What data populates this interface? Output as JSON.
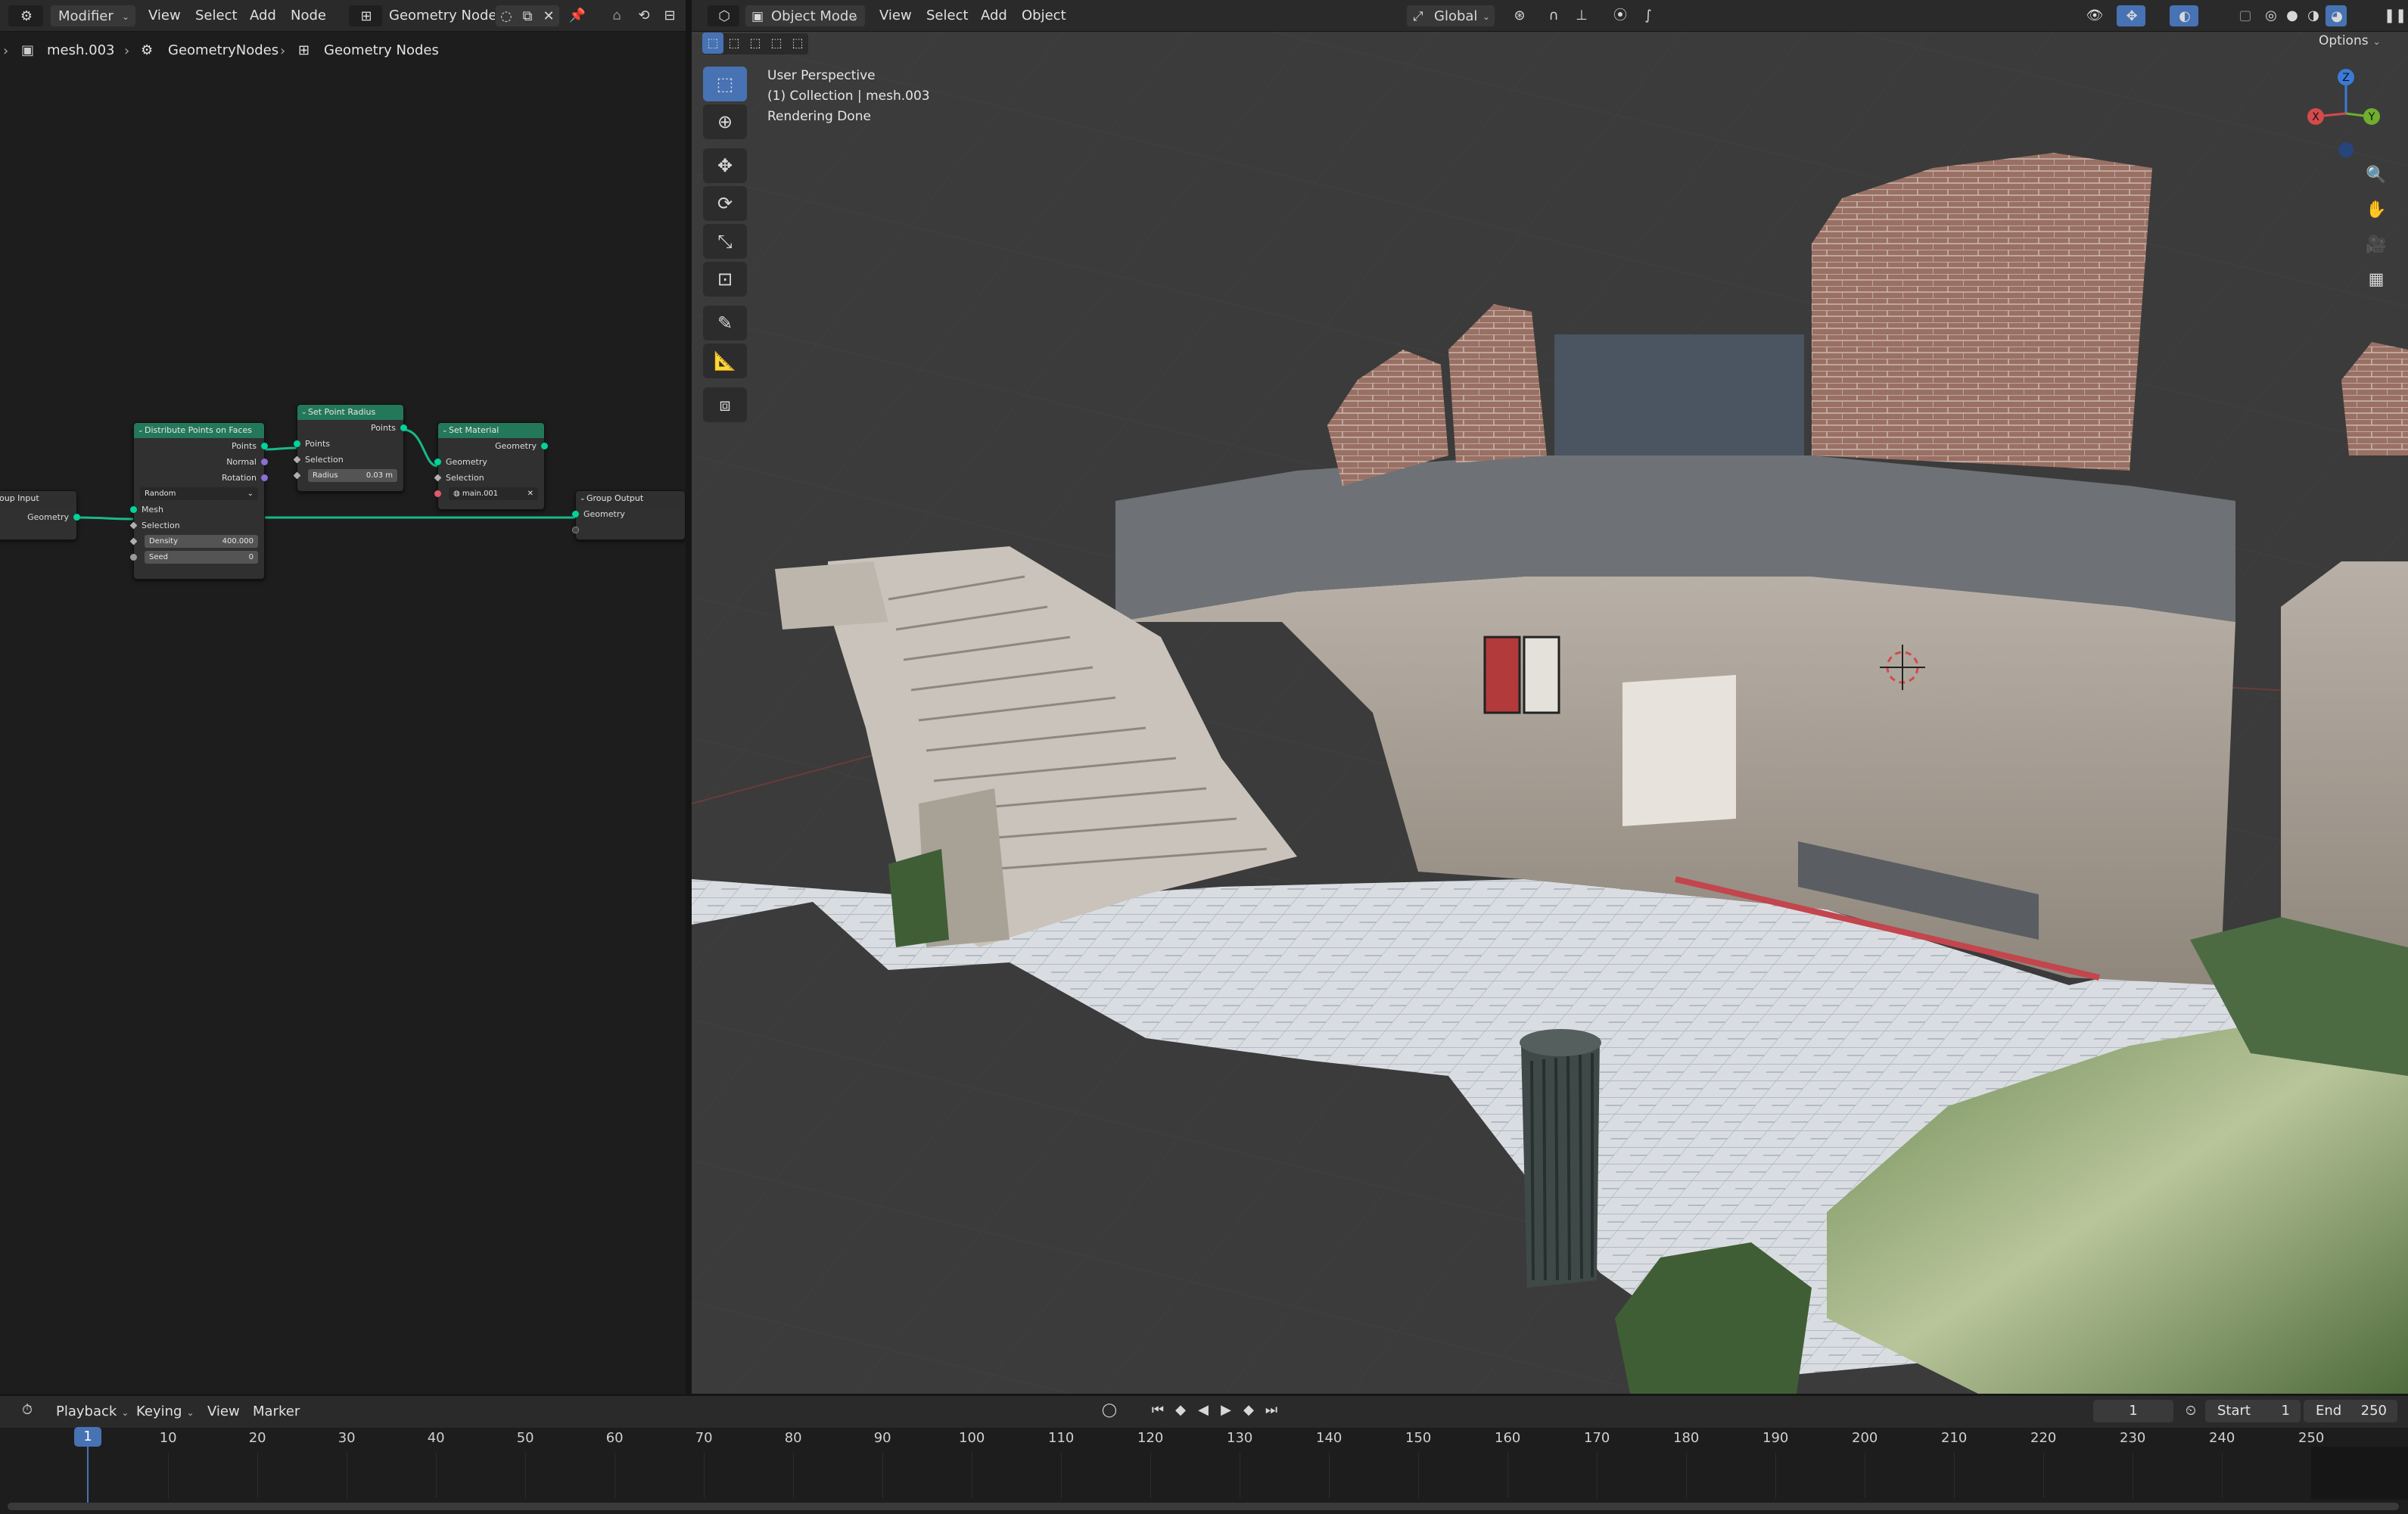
{
  "node_editor_header": {
    "editor_type_icon": "node-editor-icon",
    "context_dropdown": "Modifier",
    "menus": [
      "View",
      "Select",
      "Add",
      "Node"
    ],
    "node_tree_name": "Geometry Nodes"
  },
  "breadcrumb": {
    "object": "mesh.003",
    "modifier": "GeometryNodes",
    "node_tree": "Geometry Nodes"
  },
  "nodes": {
    "group_input": {
      "title": "oup Input",
      "outputs": [
        "Geometry"
      ]
    },
    "distribute": {
      "title": "Distribute Points on Faces",
      "outputs": [
        "Points",
        "Normal",
        "Rotation"
      ],
      "mode": "Random",
      "inputs": [
        "Mesh",
        "Selection"
      ],
      "density_label": "Density",
      "density_value": "400.000",
      "seed_label": "Seed",
      "seed_value": "0"
    },
    "set_point_radius": {
      "title": "Set Point Radius",
      "outputs": [
        "Points"
      ],
      "inputs": [
        "Points",
        "Selection"
      ],
      "radius_label": "Radius",
      "radius_value": "0.03 m"
    },
    "set_material": {
      "title": "Set Material",
      "outputs": [
        "Geometry"
      ],
      "inputs": [
        "Geometry",
        "Selection"
      ],
      "material": "main.001"
    },
    "group_output": {
      "title": "Group Output",
      "inputs": [
        "Geometry"
      ]
    }
  },
  "viewport_header": {
    "editor_type_icon": "3d-viewport-icon",
    "mode": "Object Mode",
    "menus": [
      "View",
      "Select",
      "Add",
      "Object"
    ],
    "orientation": "Global",
    "options_label": "Options"
  },
  "viewport_info": {
    "line1": "User Perspective",
    "line2": "(1) Collection | mesh.003",
    "line3": "Rendering Done"
  },
  "gizmo": {
    "x": "X",
    "y": "Y",
    "z": "Z"
  },
  "timeline_header": {
    "menus": [
      "Playback",
      "Keying",
      "View",
      "Marker"
    ],
    "current_frame": "1",
    "start_label": "Start",
    "start_value": "1",
    "end_label": "End",
    "end_value": "250"
  },
  "timeline": {
    "current": "1",
    "ticks": [
      "10",
      "20",
      "30",
      "40",
      "50",
      "60",
      "70",
      "80",
      "90",
      "100",
      "110",
      "120",
      "130",
      "140",
      "150",
      "160",
      "170",
      "180",
      "190",
      "200",
      "210",
      "220",
      "230",
      "240",
      "250"
    ]
  },
  "colors": {
    "node_header_green": "#24785a",
    "accent_blue": "#4772b3",
    "geometry_socket": "#00d49a"
  }
}
